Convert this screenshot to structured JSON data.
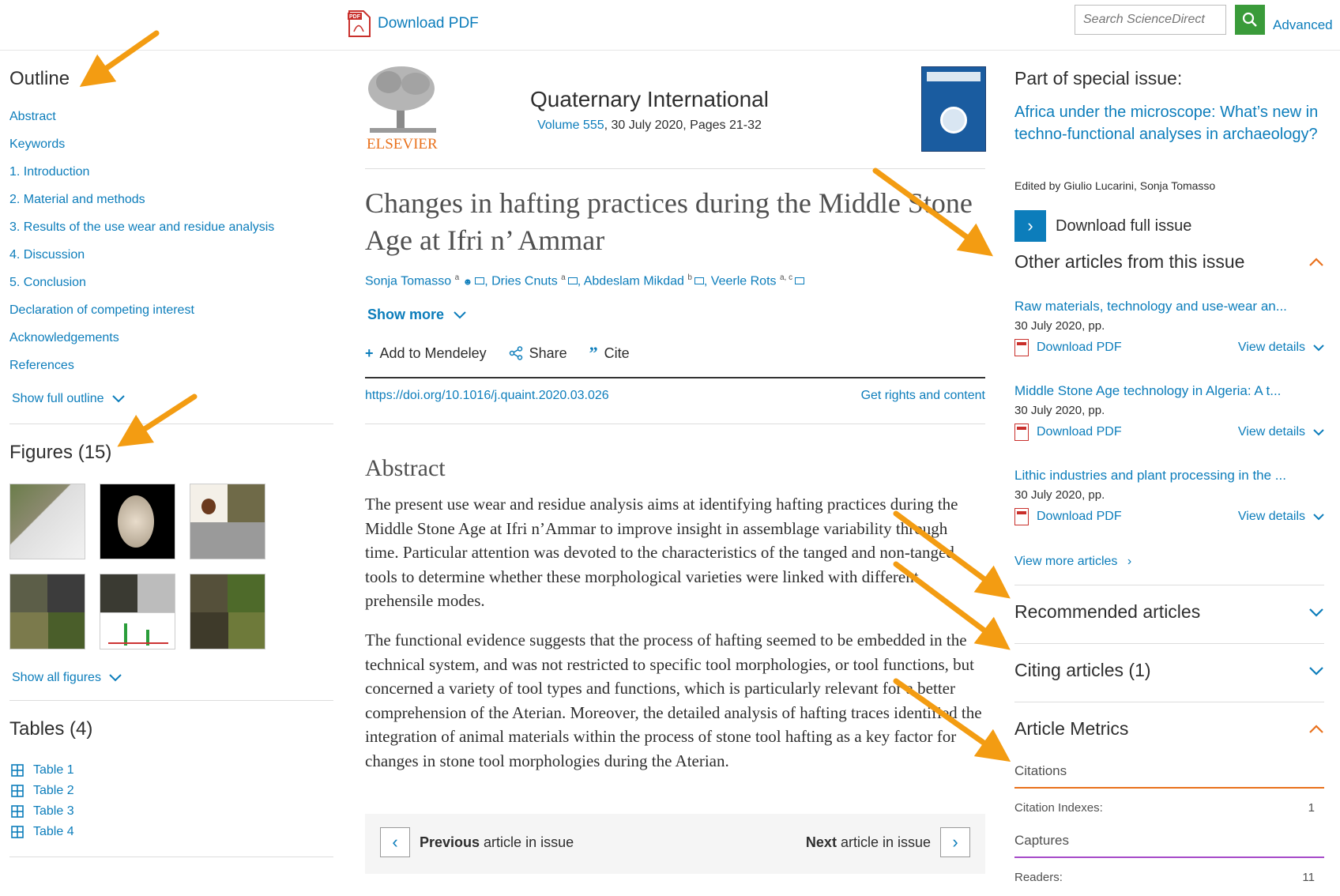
{
  "header": {
    "download_pdf": "Download PDF",
    "search_placeholder": "Search ScienceDirect",
    "advanced": "Advanced"
  },
  "outline": {
    "title": "Outline",
    "items": [
      "Abstract",
      "Keywords",
      "1. Introduction",
      "2. Material and methods",
      "3. Results of the use wear and residue analysis",
      "4. Discussion",
      "5. Conclusion",
      "Declaration of competing interest",
      "Acknowledgements",
      "References"
    ],
    "show_full": "Show full outline"
  },
  "figures": {
    "title": "Figures (15)",
    "show_all": "Show all figures"
  },
  "tables": {
    "title": "Tables (4)",
    "items": [
      "Table 1",
      "Table 2",
      "Table 3",
      "Table 4"
    ]
  },
  "journal": {
    "publisher": "ELSEVIER",
    "name": "Quaternary International",
    "volume_link": "Volume 555",
    "volume_rest": ", 30 July 2020, Pages 21-32"
  },
  "article": {
    "title": "Changes in hafting practices during the Middle Stone Age at Ifri n’ Ammar",
    "authors": [
      {
        "name": "Sonja Tomasso",
        "sup": "a"
      },
      {
        "name": "Dries Cnuts",
        "sup": "a"
      },
      {
        "name": "Abdeslam Mikdad",
        "sup": "b"
      },
      {
        "name": "Veerle Rots",
        "sup": "a, c"
      }
    ],
    "show_more": "Show more",
    "actions": {
      "mendeley": "Add to Mendeley",
      "share": "Share",
      "cite": "Cite"
    },
    "doi": "https://doi.org/10.1016/j.quaint.2020.03.026",
    "rights": "Get rights and content",
    "abstract_heading": "Abstract",
    "abstract_p1": "The present use wear and residue analysis aims at identifying hafting practices during the Middle Stone Age at Ifri n’Ammar to improve insight in assemblage variability through time. Particular attention was devoted to the characteristics of the tanged and non-tanged tools to determine whether these morphological varieties were linked with different prehensile modes.",
    "abstract_p2": "The functional evidence suggests that the process of hafting seemed to be embedded in the technical system, and was not restricted to specific tool morphologies, or tool functions, but concerned a variety of tool types and functions, which is particularly relevant for a better comprehension of the Aterian. Moreover, the detailed analysis of hafting traces identified the integration of animal materials within the process of stone tool hafting as a key factor for changes in stone tool morphologies during the Aterian.",
    "prev_bold": "Previous",
    "prev_rest": " article in issue",
    "next_bold": "Next",
    "next_rest": " article in issue"
  },
  "sidebar": {
    "special_heading": "Part of special issue:",
    "special_link": "Africa under the microscope: What’s new in techno-functional analyses in archaeology?",
    "edited_by": "Edited by Giulio Lucarini, Sonja Tomasso",
    "download_issue": "Download full issue",
    "other_heading": "Other articles from this issue",
    "articles": [
      {
        "title": "Raw materials, technology and use-wear an...",
        "date": "30 July 2020, pp.",
        "pdf": "Download PDF",
        "details": "View details"
      },
      {
        "title": "Middle Stone Age technology in Algeria: A t...",
        "date": "30 July 2020, pp.",
        "pdf": "Download PDF",
        "details": "View details"
      },
      {
        "title": "Lithic industries and plant processing in the ...",
        "date": "30 July 2020, pp.",
        "pdf": "Download PDF",
        "details": "View details"
      }
    ],
    "view_more": "View more articles",
    "recommended": "Recommended articles",
    "citing": "Citing articles (1)",
    "metrics": "Article Metrics",
    "citations_sub": "Citations",
    "citation_indexes_label": "Citation Indexes:",
    "citation_indexes_value": "1",
    "captures_sub": "Captures",
    "readers_label": "Readers:",
    "readers_value": "11"
  },
  "colors": {
    "link": "#0c7dbb",
    "accent_orange": "#f39c12",
    "search_green": "#3a9b3a"
  }
}
